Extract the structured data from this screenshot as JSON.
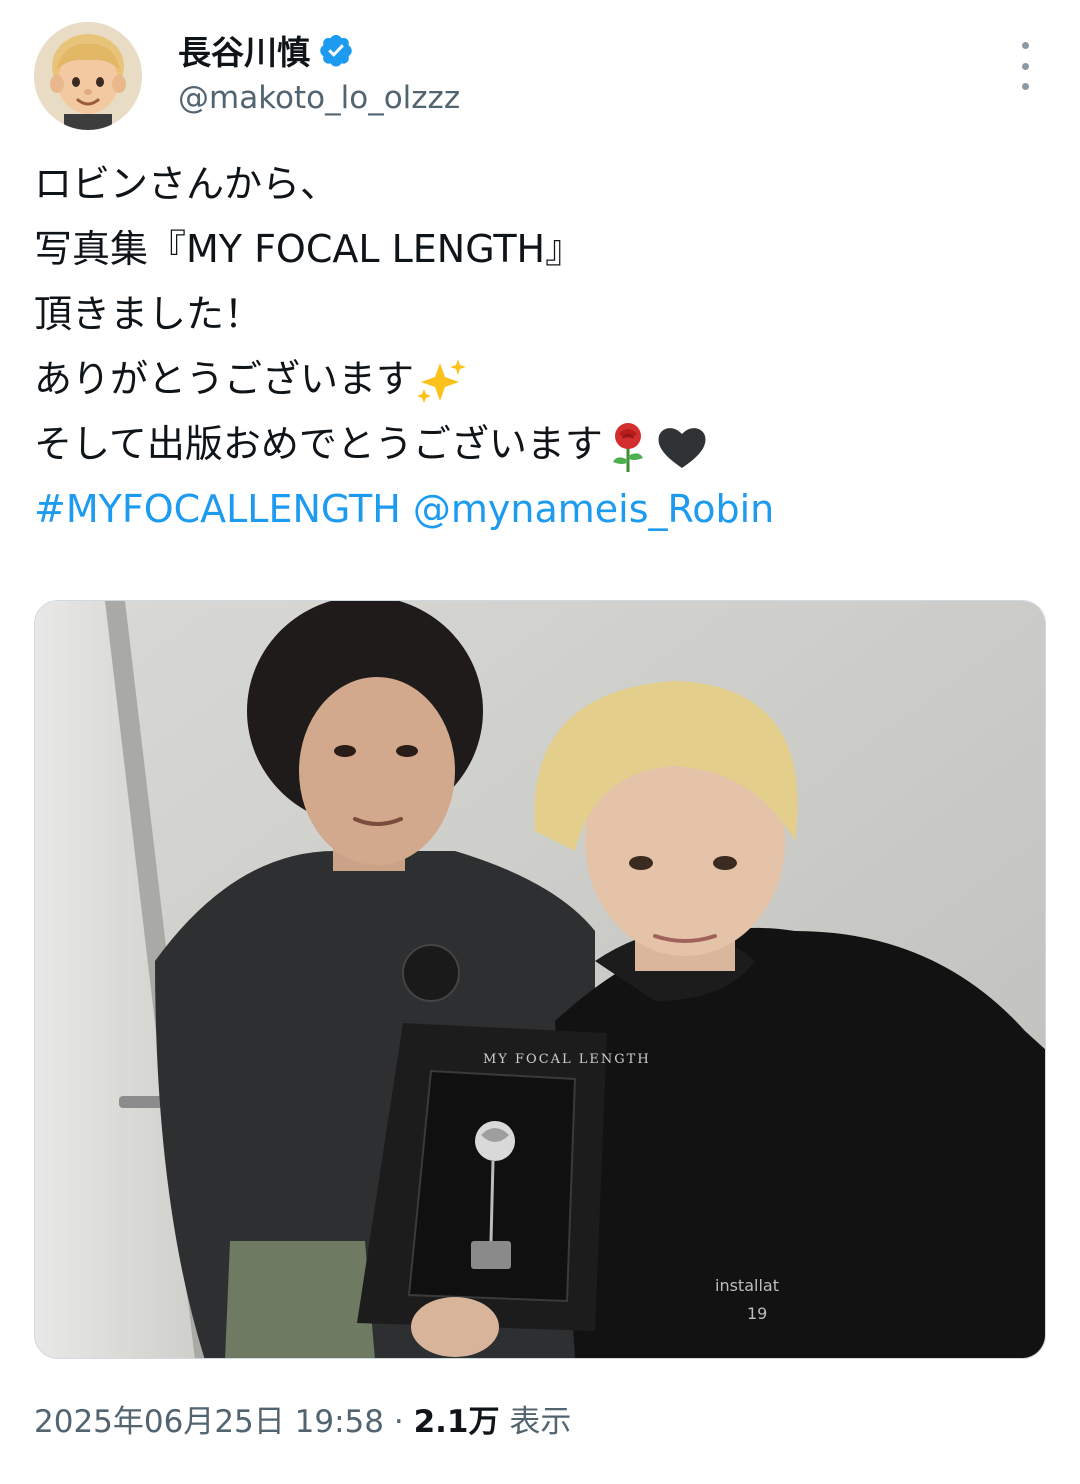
{
  "user": {
    "display_name": "長谷川慎",
    "handle": "@makoto_lo_olzzz",
    "verified_icon": "verified-badge-icon",
    "avatar_icon": "person-blond-emoji"
  },
  "tweet": {
    "lines": [
      "ロビンさんから、",
      "写真集『MY FOCAL LENGTH』",
      "頂きました！",
      "ありがとうございます",
      "そして出版おめでとうございます"
    ],
    "hashtag": "#MYFOCALLENGTH",
    "mention": "@mynameis_Robin",
    "emojis": [
      "sparkles-emoji",
      "rose-emoji",
      "black-heart-emoji"
    ]
  },
  "photo": {
    "book_title": "MY FOCAL LENGTH",
    "hoodie_text_1": "installat",
    "hoodie_text_2": "19"
  },
  "meta": {
    "timestamp": "2025年06月25日 19:58",
    "separator": "·",
    "views": "2.1万",
    "views_label": "表示"
  },
  "colors": {
    "link": "#1d9bf0",
    "secondary_text": "#536471",
    "verified": "#1d9bf0"
  }
}
